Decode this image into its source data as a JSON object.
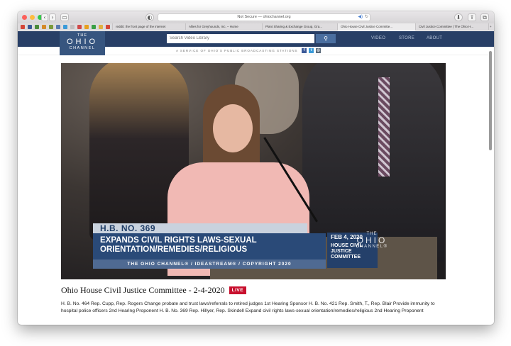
{
  "browser": {
    "url": "Not Secure — ohiochannel.org",
    "tabs": [
      "reddit: the front page of the internet",
      "Allies for Greyhounds, Inc. – Home",
      "Plant Sharing & Exchange Group, Gra...",
      "Ohio House Civil Justice Committe...",
      "Civil Justice Committee | The Ohio H..."
    ]
  },
  "site": {
    "logo_the": "THE",
    "logo_ohio": "OHIO",
    "logo_channel": "CHANNEL",
    "search_placeholder": "Search Video Library",
    "nav": [
      "VIDEO",
      "STORE",
      "ABOUT"
    ],
    "tagline": "A SERVICE OF OHIO'S PUBLIC BROADCASTING STATIONS"
  },
  "video": {
    "bill_number": "H.B. NO. 369",
    "bill_line1": "EXPANDS CIVIL RIGHTS LAWS-SEXUAL",
    "bill_line2": "ORIENTATION/REMEDIES/RELIGIOUS",
    "date": "FEB 4, 2020",
    "committee_1": "HOUSE CIVIL",
    "committee_2": "JUSTICE",
    "committee_3": "COMMITTEE",
    "copyright": "THE OHIO CHANNEL® / IDEASTREAM® / COPYRIGHT 2020",
    "wm_the": "THE",
    "wm_ohio": "OHIO",
    "wm_channel": "CHANNEL®"
  },
  "page": {
    "title": "Ohio House Civil Justice Committee - 2-4-2020",
    "live_badge": "LIVE",
    "description": "H. B. No. 464 Rep. Cupp, Rep. Rogers Change probate and trust laws/referrals to retired judges 1st Hearing Sponsor H. B. No. 421 Rep. Smith, T., Rep. Blair Provide immunity to hospital police officers 2nd Hearing Proponent H. B. No. 369 Rep. Hillyer, Rep. Skindell Expand civil rights laws-sexual orientation/remedies/religious 2nd Hearing Proponent"
  },
  "colors": {
    "header": "#283f66",
    "live": "#c8102e"
  }
}
